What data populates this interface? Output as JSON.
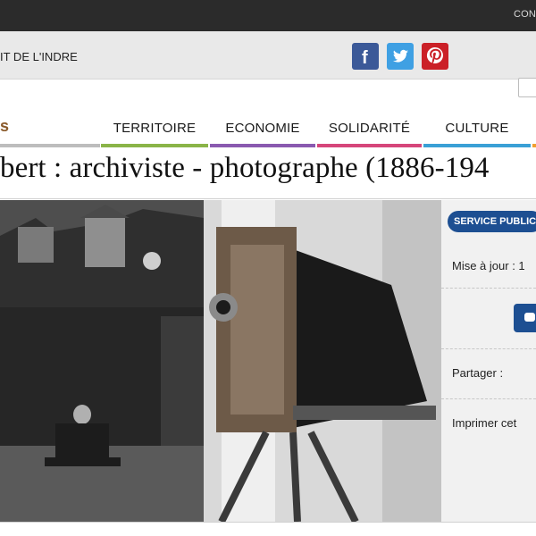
{
  "topbar": {
    "contact_label": "CON"
  },
  "band": {
    "department_label": "IT DE L'INDRE"
  },
  "social": [
    {
      "name": "facebook-icon",
      "glyph": "f"
    },
    {
      "name": "twitter-icon",
      "glyph": "t"
    },
    {
      "name": "pinterest-icon",
      "glyph": "p"
    }
  ],
  "logo_tail": "s",
  "nav": {
    "territoire": "TERRITOIRE",
    "economie": "ECONOMIE",
    "solidarite": "SOLIDARITÉ",
    "culture": "CULTURE"
  },
  "page": {
    "title": "bert : archiviste - photographe (1886-194"
  },
  "sidebar": {
    "tag": "SERVICE PUBLIC",
    "update_label": "Mise à jour : 1",
    "share_label": "Partager :",
    "print_label": "Imprimer cet"
  },
  "colors": {
    "nav_territoire": "#8ab448",
    "nav_economie": "#8a5ab0",
    "nav_solidarite": "#d6467a",
    "nav_culture": "#3aa0d6",
    "brand_blue": "#1d4f92"
  }
}
